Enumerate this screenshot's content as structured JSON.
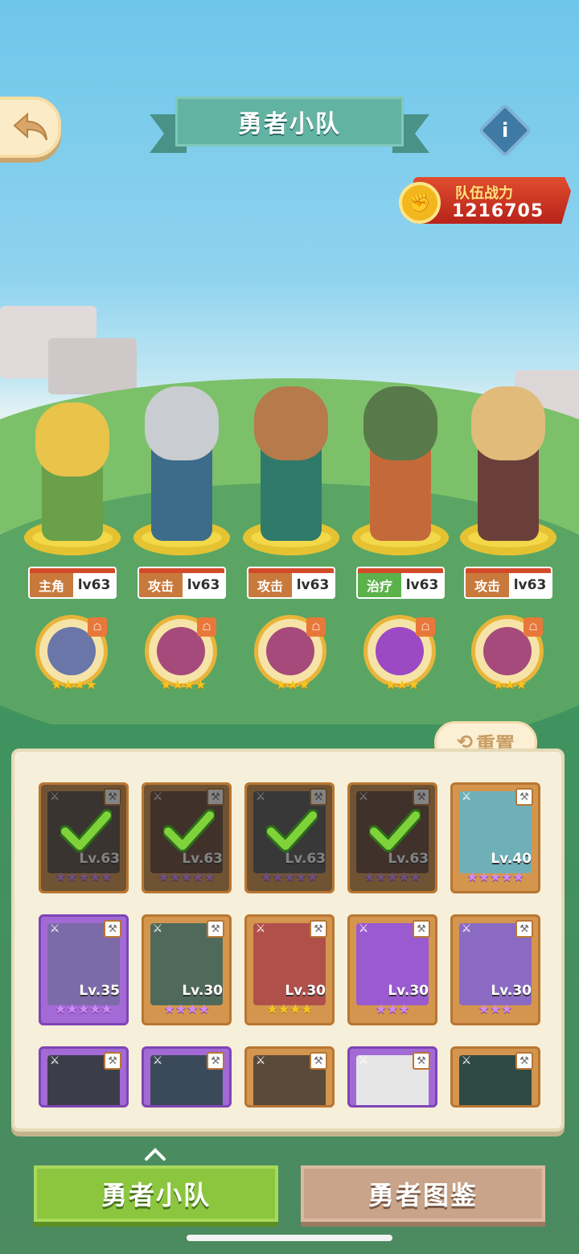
{
  "header": {
    "title": "勇者小队",
    "info_label": "i"
  },
  "power": {
    "label": "队伍战力",
    "value": "1216705"
  },
  "heroes": [
    {
      "role": "主角",
      "level": "lv63",
      "role_type": "lead",
      "color": "#e9c34a",
      "accent": "#6aa04a"
    },
    {
      "role": "攻击",
      "level": "lv63",
      "role_type": "attack",
      "color": "#c9ccd0",
      "accent": "#3d6c8a"
    },
    {
      "role": "攻击",
      "level": "lv63",
      "role_type": "attack",
      "color": "#b77a4a",
      "accent": "#2f7a6a"
    },
    {
      "role": "治疗",
      "level": "lv63",
      "role_type": "heal",
      "color": "#587a4a",
      "accent": "#c46a3a"
    },
    {
      "role": "攻击",
      "level": "lv63",
      "role_type": "attack",
      "color": "#e0bb7a",
      "accent": "#6a3f3a"
    }
  ],
  "pets": [
    {
      "stars": "★★★★",
      "color": "#6a76a8",
      "badge": "☖"
    },
    {
      "stars": "★★★★",
      "color": "#a54a7a",
      "badge": "☖"
    },
    {
      "stars": "★★★",
      "color": "#a54a7a",
      "badge": "☖"
    },
    {
      "stars": "★★★",
      "color": "#9b4ac4",
      "badge": "☖"
    },
    {
      "stars": "★★★",
      "color": "#a54a7a",
      "badge": "☖"
    }
  ],
  "reset_label": "重置",
  "cards": [
    {
      "level": "Lv.63",
      "stars": "★★★★★",
      "selected": true,
      "style": "purple-stars",
      "color": "#5d5048"
    },
    {
      "level": "Lv.63",
      "stars": "★★★★★",
      "selected": true,
      "style": "purple-stars",
      "color": "#6a4a3a"
    },
    {
      "level": "Lv.63",
      "stars": "★★★★★",
      "selected": true,
      "style": "purple-stars",
      "color": "#5a5a5a"
    },
    {
      "level": "Lv.63",
      "stars": "★★★★★",
      "selected": true,
      "style": "purple-stars",
      "color": "#6a4b3b"
    },
    {
      "level": "Lv.40",
      "stars": "★★★★★",
      "selected": false,
      "style": "purple-stars",
      "color": "#6fb0b8"
    },
    {
      "level": "Lv.35",
      "stars": "★★★★★",
      "selected": false,
      "style": "purple-stars",
      "frame": "purple",
      "color": "#7d6aa8"
    },
    {
      "level": "Lv.30",
      "stars": "★★★★",
      "selected": false,
      "style": "purple-stars",
      "color": "#4f6a5a"
    },
    {
      "level": "Lv.30",
      "stars": "★★★★",
      "selected": false,
      "style": "gold-stars",
      "color": "#b0504a"
    },
    {
      "level": "Lv.30",
      "stars": "★★★",
      "selected": false,
      "style": "purple-stars",
      "color": "#9a5ad0"
    },
    {
      "level": "Lv.30",
      "stars": "★★★",
      "selected": false,
      "style": "purple-stars",
      "color": "#8b6ac4"
    },
    {
      "level": "",
      "stars": "",
      "selected": false,
      "partial": true,
      "frame": "purple",
      "color": "#3d3d4a"
    },
    {
      "level": "",
      "stars": "",
      "selected": false,
      "partial": true,
      "frame": "purple",
      "color": "#3a4a5a"
    },
    {
      "level": "",
      "stars": "",
      "selected": false,
      "partial": true,
      "color": "#5a4a3a"
    },
    {
      "level": "",
      "stars": "",
      "selected": false,
      "partial": true,
      "frame": "purple",
      "color": "#e6e6e6"
    },
    {
      "level": "",
      "stars": "",
      "selected": false,
      "partial": true,
      "color": "#2f4a44"
    }
  ],
  "tabs": {
    "active": "勇者小队",
    "inactive": "勇者图鉴"
  }
}
